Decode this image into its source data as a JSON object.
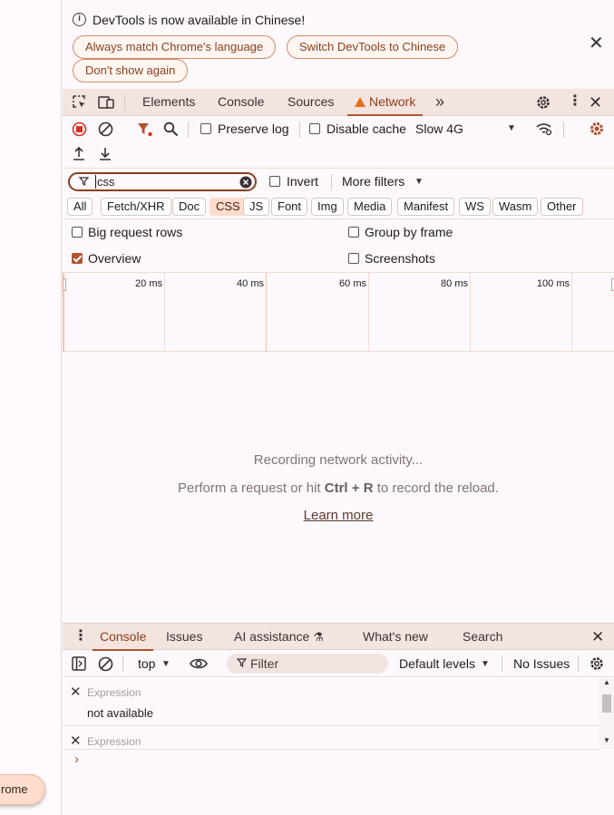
{
  "page": {
    "floating_button": "rome"
  },
  "infobar": {
    "message": "DevTools is now available in Chinese!",
    "btn_match": "Always match Chrome's language",
    "btn_switch": "Switch DevTools to Chinese",
    "btn_dont_show": "Don't show again"
  },
  "main_tabs": {
    "elements": "Elements",
    "console": "Console",
    "sources": "Sources",
    "network": "Network"
  },
  "network_toolbar": {
    "preserve_log": "Preserve log",
    "disable_cache": "Disable cache",
    "throttling": "Slow 4G"
  },
  "filter": {
    "value": "css",
    "invert": "Invert",
    "more_filters": "More filters"
  },
  "types": [
    "All",
    "Fetch/XHR",
    "Doc",
    "CSS",
    "JS",
    "Font",
    "Img",
    "Media",
    "Manifest",
    "WS",
    "Wasm",
    "Other"
  ],
  "options": {
    "big_rows": "Big request rows",
    "group_frame": "Group by frame",
    "overview": "Overview",
    "screenshots": "Screenshots"
  },
  "timeline": {
    "ticks": [
      "20 ms",
      "40 ms",
      "60 ms",
      "80 ms",
      "100 ms"
    ]
  },
  "empty": {
    "recording": "Recording network activity...",
    "hint_pre": "Perform a request or hit ",
    "hint_keys": "Ctrl + R",
    "hint_post": " to record the reload.",
    "learn_more": "Learn more"
  },
  "drawer": {
    "tabs": {
      "console": "Console",
      "issues": "Issues",
      "ai": "AI assistance",
      "whats_new": "What's new",
      "search": "Search"
    },
    "context": "top",
    "filter_placeholder": "Filter",
    "levels": "Default levels",
    "issues_status": "No Issues",
    "expressions": [
      {
        "label": "Expression",
        "value": "not available"
      },
      {
        "label": "Expression",
        "value": ""
      }
    ],
    "prompt": "›"
  },
  "colors": {
    "accent": "#b0542f",
    "tab_bg": "#f4e4df",
    "active_chip": "#ffdccc",
    "warning": "#e3701f",
    "record": "#d93025"
  }
}
